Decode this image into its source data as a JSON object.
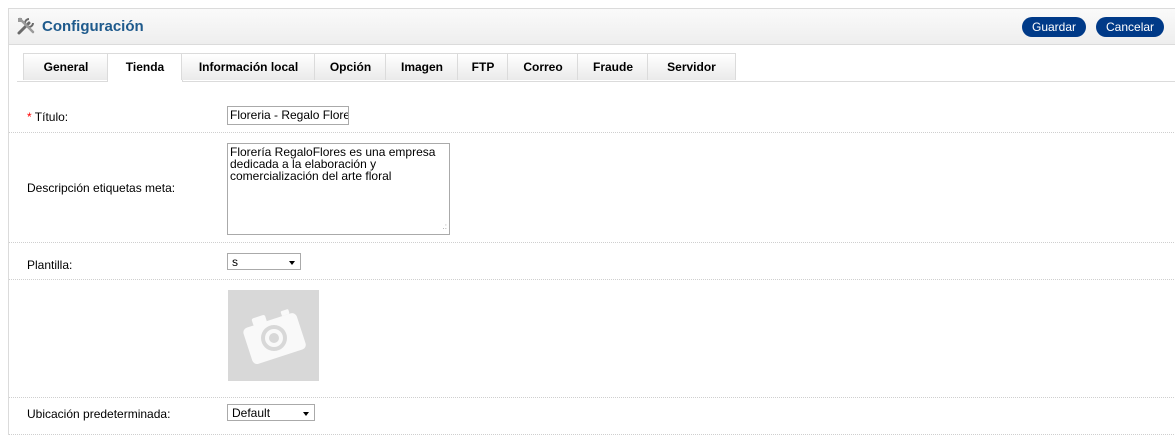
{
  "header": {
    "title": "Configuración",
    "save_label": "Guardar",
    "cancel_label": "Cancelar"
  },
  "tabs": [
    {
      "label": "General"
    },
    {
      "label": "Tienda"
    },
    {
      "label": "Información local"
    },
    {
      "label": "Opción"
    },
    {
      "label": "Imagen"
    },
    {
      "label": "FTP"
    },
    {
      "label": "Correo"
    },
    {
      "label": "Fraude"
    },
    {
      "label": "Servidor"
    }
  ],
  "active_tab": "Tienda",
  "form": {
    "title_required_mark": "*",
    "title_label": "Título:",
    "title_value": "Floreria - Regalo Flore",
    "meta_label": "Descripción etiquetas meta:",
    "meta_value": "Florería RegaloFlores  es una empresa dedicada a la elaboración y comercialización del arte floral",
    "template_label": "Plantilla:",
    "template_value": "s",
    "default_location_label": "Ubicación predeterminada:",
    "default_location_value": "Default"
  },
  "colors": {
    "accent": "#003a88",
    "title": "#1e5a8c",
    "required": "#ff0000"
  },
  "icons": {
    "header": "tools-icon",
    "template_preview": "camera-icon"
  }
}
